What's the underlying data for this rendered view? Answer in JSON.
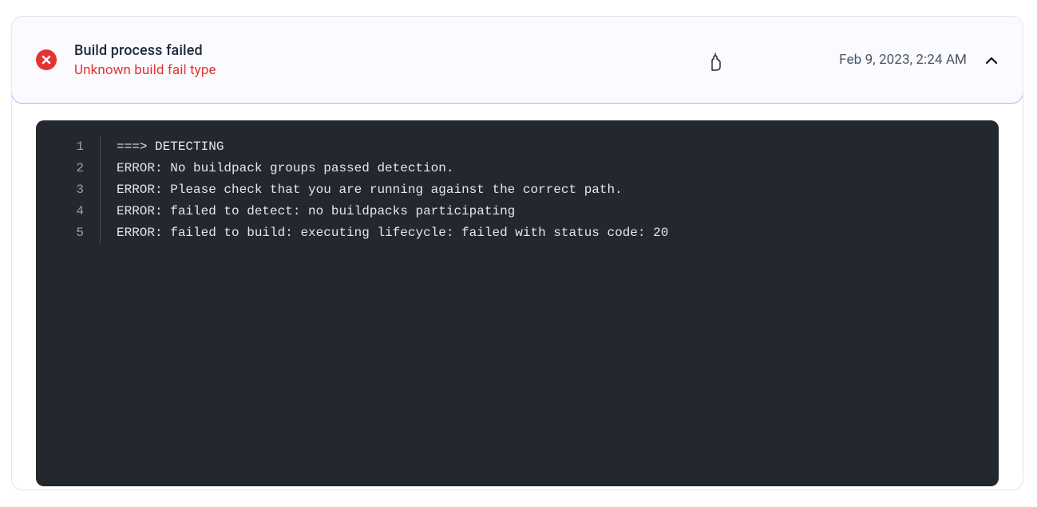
{
  "header": {
    "title": "Build process failed",
    "subtitle": "Unknown build fail type",
    "timestamp": "Feb 9, 2023, 2:24 AM"
  },
  "log": {
    "lines": [
      {
        "n": "1",
        "text": "===> DETECTING"
      },
      {
        "n": "2",
        "text": "ERROR: No buildpack groups passed detection."
      },
      {
        "n": "3",
        "text": "ERROR: Please check that you are running against the correct path."
      },
      {
        "n": "4",
        "text": "ERROR: failed to detect: no buildpacks participating"
      },
      {
        "n": "5",
        "text": "ERROR: failed to build: executing lifecycle: failed with status code: 20"
      }
    ]
  }
}
